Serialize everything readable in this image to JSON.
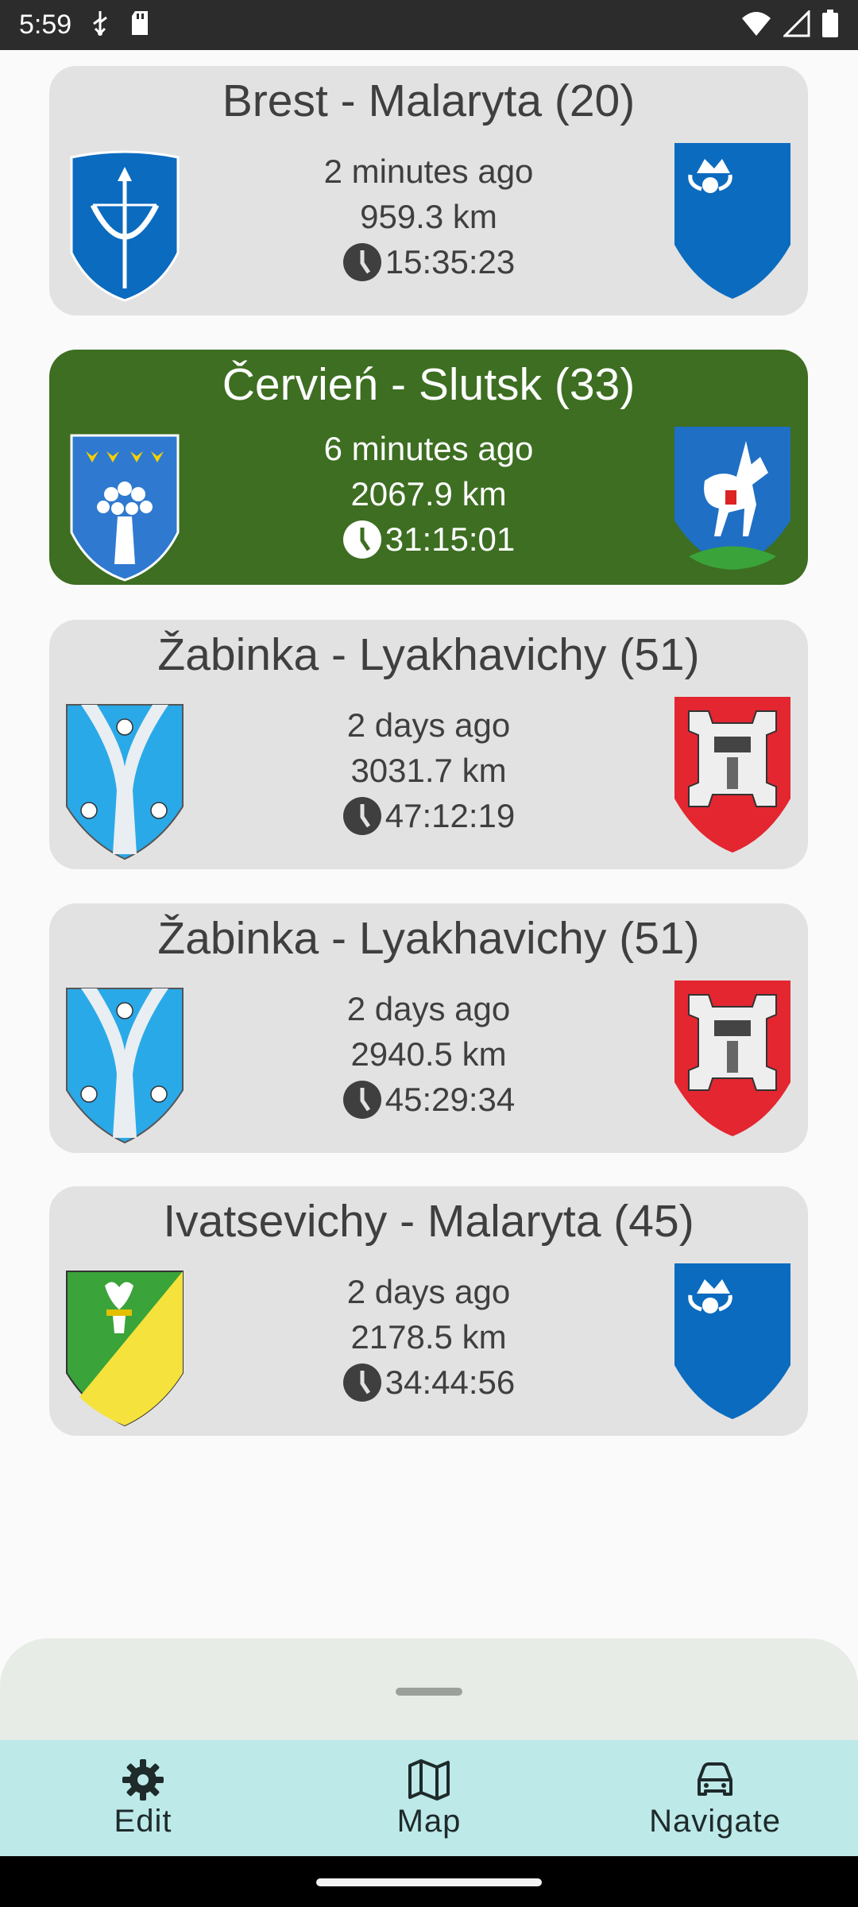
{
  "status_bar": {
    "time": "5:59",
    "left_icons": [
      "usb-icon",
      "sd-card-icon"
    ],
    "right_icons": [
      "wifi-icon",
      "signal-icon",
      "battery-icon"
    ]
  },
  "routes": [
    {
      "title": "Brest - Malaryta (20)",
      "time_ago": "2 minutes ago",
      "distance": "959.3 km",
      "duration": "15:35:23",
      "selected": false,
      "left_crest": "brest-crest-icon",
      "right_crest": "malaryta-crest-icon"
    },
    {
      "title": "Červień - Slutsk (33)",
      "time_ago": "6 minutes ago",
      "distance": "2067.9 km",
      "duration": "31:15:01",
      "selected": true,
      "left_crest": "chervien-crest-icon",
      "right_crest": "slutsk-crest-icon"
    },
    {
      "title": "Žabinka - Lyakhavichy (51)",
      "time_ago": "2 days ago",
      "distance": "3031.7 km",
      "duration": "47:12:19",
      "selected": false,
      "left_crest": "zabinka-crest-icon",
      "right_crest": "lyakhavichy-crest-icon"
    },
    {
      "title": "Žabinka - Lyakhavichy (51)",
      "time_ago": "2 days ago",
      "distance": "2940.5 km",
      "duration": "45:29:34",
      "selected": false,
      "left_crest": "zabinka-crest-icon",
      "right_crest": "lyakhavichy-crest-icon"
    },
    {
      "title": "Ivatsevichy - Malaryta (45)",
      "time_ago": "2 days ago",
      "distance": "2178.5 km",
      "duration": "34:44:56",
      "selected": false,
      "left_crest": "ivatsevichy-crest-icon",
      "right_crest": "malaryta-crest-icon"
    }
  ],
  "bottom_nav": {
    "items": [
      {
        "label": "Edit",
        "icon": "gear-icon"
      },
      {
        "label": "Map",
        "icon": "map-icon"
      },
      {
        "label": "Navigate",
        "icon": "car-icon"
      }
    ]
  },
  "colors": {
    "card_bg": "#e2e2e2",
    "selected_card_bg": "#3d6e21",
    "nav_bg": "#bde9e9",
    "sheet_bg": "#e8ece6"
  }
}
